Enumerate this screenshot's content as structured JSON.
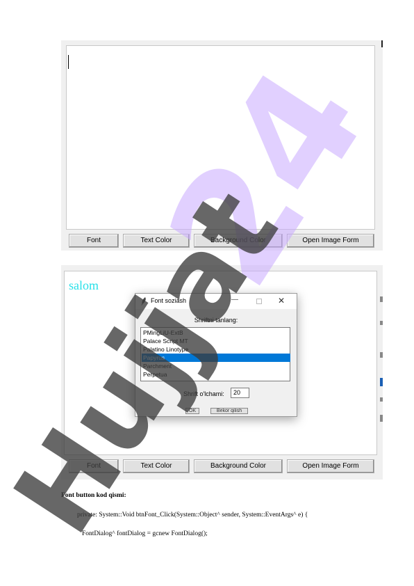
{
  "screenshot_top": {
    "buttons": [
      "Font",
      "Text Color",
      "Background Color",
      "Open Image Form"
    ]
  },
  "screenshot_bottom": {
    "textarea_text": "salom",
    "buttons": [
      "Font",
      "Text Color",
      "Background Color",
      "Open Image Form"
    ],
    "dialog": {
      "title": "Font soziash",
      "label": "Shriftni tanlang:",
      "fonts": [
        "PMingLiU-ExtB",
        "Palace Script MT",
        "Palatino Linotype",
        "Papyrus",
        "Parchment",
        "Perpetua"
      ],
      "selected_index": 3,
      "size_label": "Shrift o'lchami:",
      "size_value": "20",
      "ok_label": "OK",
      "cancel_label": "Bekor qilish"
    }
  },
  "heading": "Font button kod qismi:",
  "code_lines": [
    "private: System::Void btnFont_Click(System::Object^ sender, System::EventArgs^ e) {",
    "FontDialog^ fontDialog = gcnew FontDialog();"
  ],
  "watermark": {
    "number": "24",
    "word": "Hujjat",
    "number_color": "#c8aaff",
    "word_color": "#3c3c3c"
  },
  "colors": {
    "selection": "#0078d7",
    "salom_text": "#28e0e8"
  }
}
